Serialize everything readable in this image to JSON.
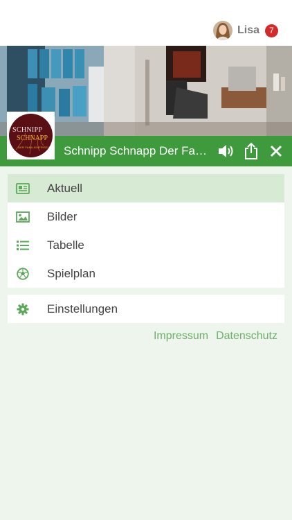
{
  "user": {
    "name": "Lisa",
    "badge_count": "7"
  },
  "club": {
    "title": "Schnipp Schnapp Der Familienfriseur",
    "logo_line1": "SCHNIPP",
    "logo_line2": "SCHNAPP",
    "logo_line3": "DER FAMILIENFRISEUR"
  },
  "toolbar": {
    "sound_icon": "speaker-icon",
    "share_icon": "share-icon",
    "close_icon": "close-icon"
  },
  "menu": {
    "items": [
      {
        "label": "Aktuell",
        "icon": "newspaper-icon",
        "active": true
      },
      {
        "label": "Bilder",
        "icon": "image-icon",
        "active": false
      },
      {
        "label": "Tabelle",
        "icon": "list-icon",
        "active": false
      },
      {
        "label": "Spielplan",
        "icon": "soccer-ball-icon",
        "active": false
      }
    ],
    "settings": {
      "label": "Einstellungen",
      "icon": "gear-icon"
    }
  },
  "footer_links": {
    "impressum": "Impressum",
    "datenschutz": "Datenschutz"
  },
  "colors": {
    "green": "#3f9a3e",
    "active_bg": "#d6ead4",
    "link": "#6db06a",
    "badge": "#d42a2a",
    "background": "#eef5ec"
  }
}
